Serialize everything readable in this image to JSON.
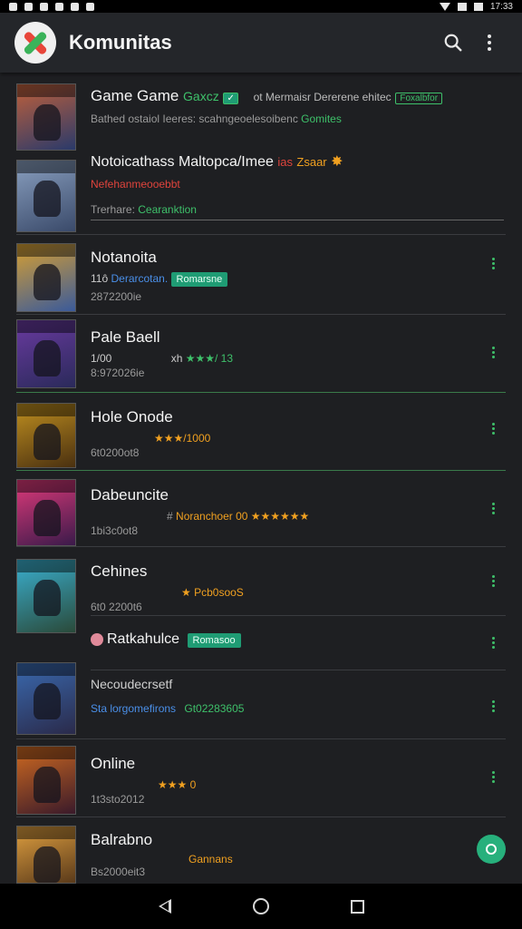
{
  "status_bar": {
    "time": "17:33"
  },
  "app_bar": {
    "title": "Komunitas",
    "search_icon": "search-icon",
    "menu_icon": "more-vert-icon"
  },
  "accent_colors": {
    "green": "#3ec06a",
    "teal": "#1f9c74",
    "orange": "#f0a020",
    "red": "#e0443c"
  },
  "items": [
    {
      "title": "Game Game",
      "title_tag": "Gaxcz",
      "meta": "ot Mermaisr Dererene ehitec",
      "meta_badge": "Foxalbfor",
      "sub": "Bathed ostaiol Ieeres: scahngeoelesoibenc",
      "sub_tag": "Gomites",
      "colors": [
        "#c0603a",
        "#2a3a6a"
      ]
    },
    {
      "title": "Notoicathass Maltopca/Imee",
      "title_tag": "ias",
      "title_tag2": "Zsaar",
      "sub": "Nefehanmeooebbt",
      "sub2_prefix": "Trerhare:",
      "sub2_tag": "Cearanktion",
      "colors": [
        "#8aa0c0",
        "#3a4a6a"
      ]
    },
    {
      "title": "Notanoita",
      "line1": "11ô",
      "line1_tag": "Derarcotan.",
      "line1_badge": "Romarsne",
      "line2": "2872200ie",
      "colors": [
        "#d8a030",
        "#3a5a9a"
      ]
    },
    {
      "title": "Pale Baell",
      "line1": "1/00",
      "line2": "8:972026ie",
      "rating_prefix": "xh",
      "rating_text": "★★★/ 13",
      "colors": [
        "#6a3aa0",
        "#2a2a5a"
      ]
    },
    {
      "title": "Hole Onode",
      "line2": "6t0200ot8",
      "rating_text": "★★★/1000",
      "colors": [
        "#c09020",
        "#4a3010"
      ]
    },
    {
      "title": "Dabeuncite",
      "line2": "1bi3c0ot8",
      "rating_prefix": "#",
      "rating_label": "Noranchoer 00",
      "rating_text": "★★★★★★",
      "colors": [
        "#e03a7a",
        "#3a1a4a"
      ]
    },
    {
      "title": "Cehines",
      "line2": "6t0 2200t6",
      "rating_text": "★ Pcb0sooS",
      "colors": [
        "#3ab0d0",
        "#2a4a3a"
      ]
    },
    {
      "title": "Ratkahulce",
      "badge": "Romasoo",
      "colors": []
    },
    {
      "title": "Necoudecrsetf",
      "line2_blue": "Sta lorgomefirons",
      "line2_green": "Gt02283605",
      "colors": [
        "#3a6ab0",
        "#2a2a4a"
      ]
    },
    {
      "title": "Online",
      "line2": "1t3sto2012",
      "rating_text": "★★★ 0",
      "colors": [
        "#d06a20",
        "#3a1a2a"
      ]
    },
    {
      "title": "Balrabno",
      "line2": "Bs2000eit3",
      "rating_text": "Gannans",
      "colors": [
        "#e0a040",
        "#5a3a1a"
      ]
    }
  ],
  "nav_bar": {
    "back": "back-icon",
    "home": "home-icon",
    "recent": "recent-apps-icon"
  }
}
